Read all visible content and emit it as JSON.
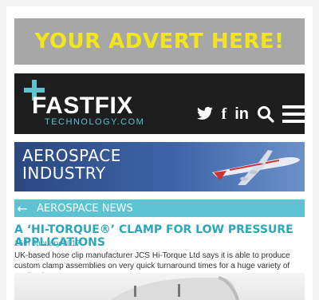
{
  "ad": {
    "text": "YOUR ADVERT HERE!"
  },
  "header": {
    "logo_word": "FASTFIX",
    "logo_sub": "TECHNOLOGY.COM"
  },
  "banner": {
    "line1": "AEROSPACE",
    "line2": "INDUSTRY"
  },
  "news": {
    "section_label": "AEROSPACE NEWS",
    "headline": "A ‘HI-TORQUE®’ CLAMP FOR LOW PRESSURE APPLICATIONS",
    "date": "25th January 2017",
    "description": "UK-based hose clip manufacturer JCS Hi-Torque Ltd says it is able to produce custom clamp assemblies on very quick turnaround times for a huge variety of applications."
  },
  "icons": {
    "twitter": "twitter-icon",
    "facebook": "facebook-icon",
    "linkedin": "linkedin-icon",
    "search": "search-icon",
    "menu": "menu-icon",
    "back": "arrow-left-icon"
  },
  "colors": {
    "ad_text": "#f2e61b",
    "ad_bg": "#a7a7a7",
    "header_bg": "#1e1e1e",
    "accent": "#5bc3d2",
    "headline": "#2aa6bd"
  }
}
